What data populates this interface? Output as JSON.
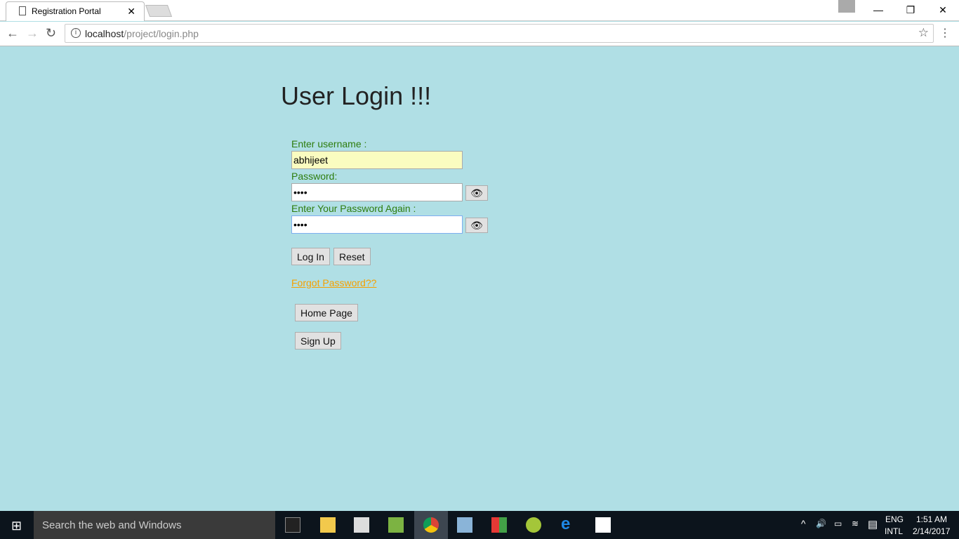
{
  "browser": {
    "tab_title": "Registration Portal",
    "url_host": "localhost",
    "url_path": "/project/login.php"
  },
  "page": {
    "title": "User Login !!!",
    "username_label": "Enter username :",
    "username_value": "abhijeet",
    "password_label": "Password:",
    "password_value": "abcd",
    "confirm_label": "Enter Your Password Again :",
    "confirm_value": "abcd",
    "login_label": "Log In",
    "reset_label": "Reset",
    "forgot_label": "Forgot Password??",
    "home_label": "Home Page",
    "signup_label": "Sign Up"
  },
  "taskbar": {
    "search_placeholder": "Search the web and Windows",
    "lang1": "ENG",
    "lang2": "INTL",
    "time": "1:51 AM",
    "date": "2/14/2017"
  }
}
